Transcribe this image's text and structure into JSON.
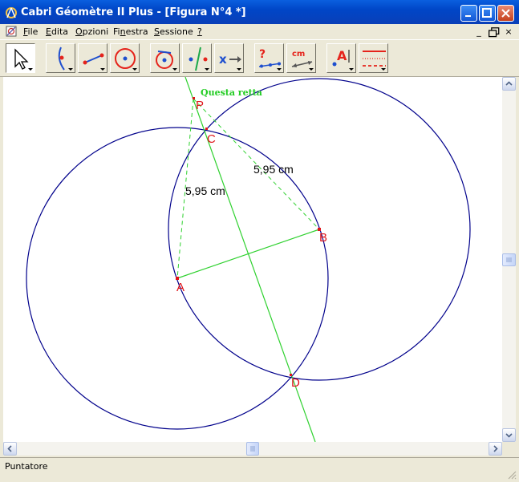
{
  "window": {
    "title": "Cabri Géomètre II Plus - [Figura N°4 *]"
  },
  "menu": {
    "items": [
      {
        "label": "File",
        "underline": "F",
        "rest": "ile"
      },
      {
        "label": "Edita",
        "underline": "E",
        "rest": "dita"
      },
      {
        "label": "Opzioni",
        "underline": "O",
        "rest": "pzioni"
      },
      {
        "label": "Finestra",
        "underline": "n",
        "pre": "Fi",
        "rest": "estra"
      },
      {
        "label": "Sessione",
        "underline": "S",
        "rest": "essione"
      },
      {
        "label": "?",
        "underline": "?",
        "rest": ""
      }
    ],
    "mdi": {
      "minimize": "_",
      "restore": "1",
      "close": "×"
    }
  },
  "toolbar": {
    "tools": [
      {
        "name": "pointer",
        "icon": "pointer-icon"
      },
      {
        "name": "curve",
        "icon": "curve-icon"
      },
      {
        "name": "segment",
        "icon": "segment-icon"
      },
      {
        "name": "circle",
        "icon": "circle-icon"
      },
      {
        "name": "rotate",
        "icon": "rotate-icon"
      },
      {
        "name": "perpendicular",
        "icon": "perpendicular-line-icon"
      },
      {
        "name": "transform",
        "icon": "reflect-icon"
      },
      {
        "name": "check-property",
        "icon": "check-property-icon",
        "label": "?"
      },
      {
        "name": "measure",
        "icon": "measure-icon",
        "label": "cm"
      },
      {
        "name": "text",
        "icon": "text-label-icon",
        "label": "A"
      },
      {
        "name": "style",
        "icon": "line-style-icon"
      }
    ]
  },
  "figure": {
    "points": {
      "A": "A",
      "B": "B",
      "C": "C",
      "D": "D",
      "P": "P"
    },
    "measure_pa": "5,95 cm",
    "measure_pb": "5,95 cm",
    "line_note": "Questa retta",
    "colors": {
      "circle": "#00008b",
      "line": "#2fd12f",
      "label": "#e0151a",
      "note": "#22cc22"
    }
  },
  "status": {
    "text": "Puntatore"
  }
}
